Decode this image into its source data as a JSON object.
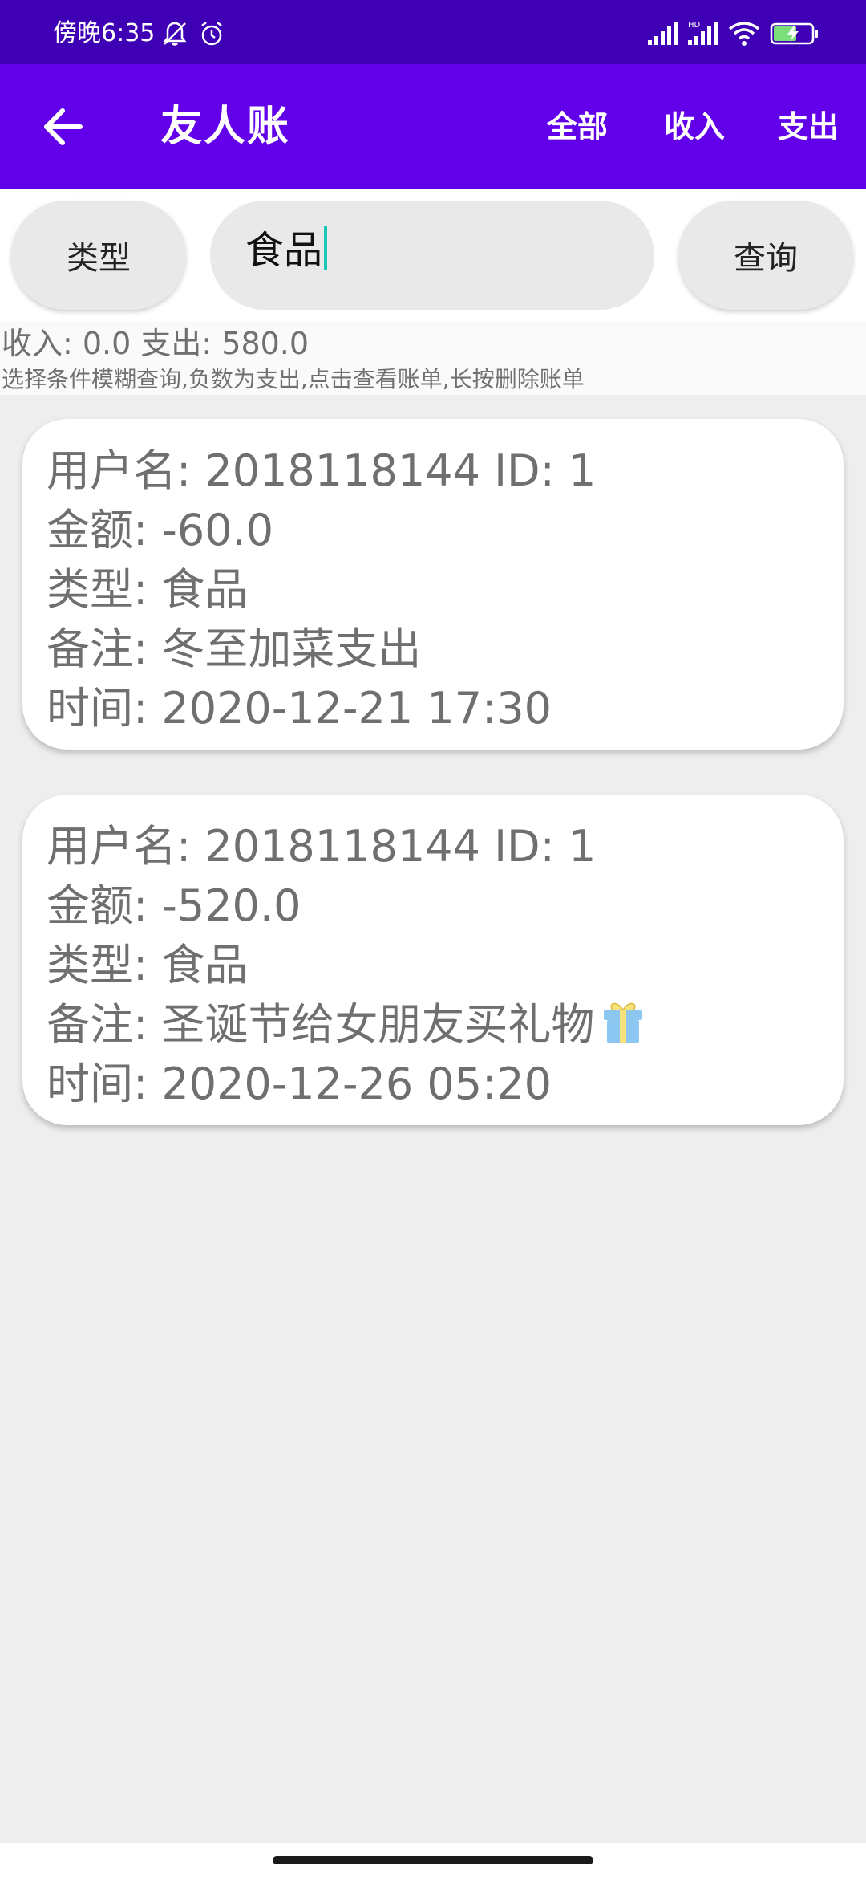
{
  "status_bar": {
    "time": "傍晚6:35",
    "icons": [
      "bell-off-icon",
      "alarm-icon",
      "signal-icon",
      "hd-signal-icon",
      "wifi-icon",
      "battery-charging-icon"
    ]
  },
  "app_bar": {
    "title": "友人账",
    "back_icon": "arrow-left-icon",
    "actions": {
      "all": "全部",
      "income": "收入",
      "expense": "支出"
    }
  },
  "search": {
    "type_button": "类型",
    "input_value": "食品",
    "query_button": "查询"
  },
  "summary": {
    "totals": "收入: 0.0 支出: 580.0",
    "hint": "选择条件模糊查询,负数为支出,点击查看账单,长按删除账单"
  },
  "records": [
    {
      "user": "用户名: 2018118144  ID: 1",
      "amount": "金额: -60.0",
      "type": "类型: 食品",
      "note": "备注: 冬至加菜支出",
      "time": "时间: 2020-12-21 17:30"
    },
    {
      "user": "用户名: 2018118144  ID: 1",
      "amount": "金额: -520.0",
      "type": "类型: 食品",
      "note": "备注: 圣诞节给女朋友买礼物",
      "time": "时间: 2020-12-26 05:20"
    }
  ],
  "colors": {
    "status_bar": "#3f00b5",
    "app_bar": "#6200ea",
    "caret": "#1ec7b5",
    "card_text": "#6f6f6f",
    "page_bg": "#eeeeee"
  }
}
